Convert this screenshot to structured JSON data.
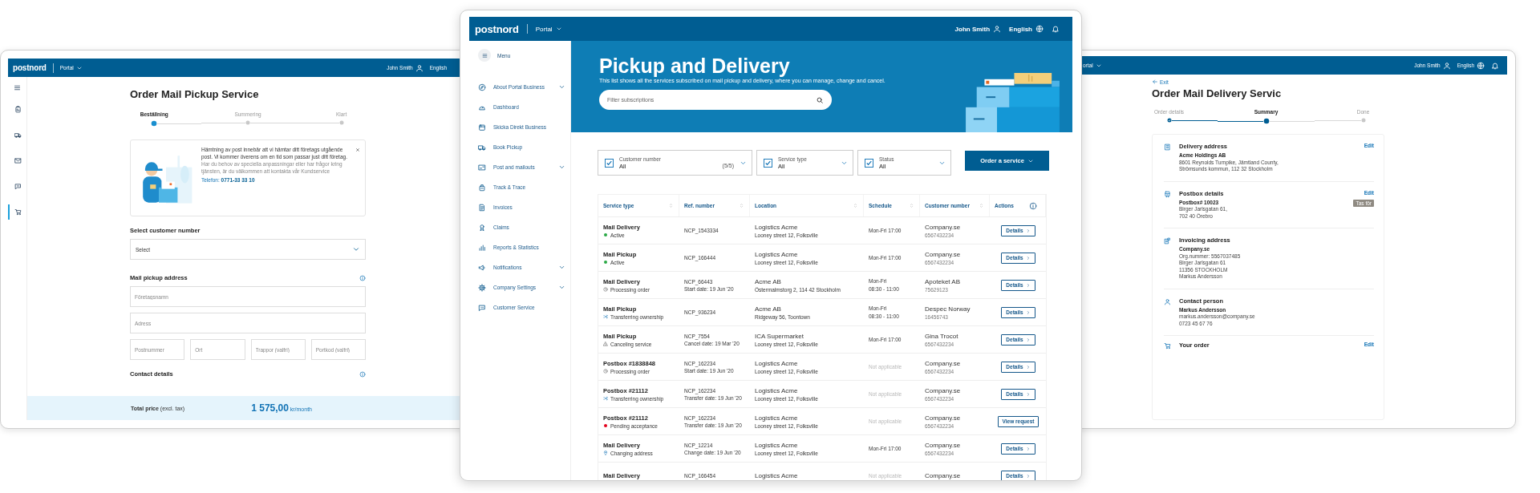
{
  "left_window": {
    "header": {
      "logo": "postnord",
      "portal": "Portal",
      "user": "John Smith",
      "language": "English"
    },
    "rail": [
      {
        "selected": false
      },
      {
        "selected": false
      },
      {
        "selected": false
      },
      {
        "selected": false
      },
      {
        "selected": true
      }
    ],
    "title": "Order Mail Pickup Service",
    "steps": [
      {
        "label": "Beställning",
        "selected": true,
        "done": false
      },
      {
        "label": "Summering",
        "selected": false,
        "done": false
      },
      {
        "label": "Klart",
        "selected": false,
        "done": false
      }
    ],
    "info": {
      "text": "Hämtning av post innebär att vi hämtar ditt företags utgående post. Vi kommer överens om en tid som passar just ditt företag.",
      "note": "Har du behov av speciella anpassningar eller har frågor kring tjänsten, är du välkommen att kontakta vår Kundservice",
      "phone_label": "Telefon:",
      "phone": "0771-33 33 10"
    },
    "customer_heading": "Select customer number",
    "customer_select": "Select",
    "address_heading": "Mail pickup address",
    "address_fields": [
      {
        "placeholder": "Företagsnamn"
      },
      {
        "placeholder": "Adress"
      }
    ],
    "address_small_fields": [
      {
        "placeholder": "Postnummer"
      },
      {
        "placeholder": "Ort"
      },
      {
        "placeholder": "Trappor (valfri)"
      },
      {
        "placeholder": "Portkod (valfri)"
      }
    ],
    "contact_heading": "Contact details",
    "total": {
      "label": "Total price",
      "note": "(excl. tax)",
      "amount": "1 575,00",
      "unit": "kr/month"
    }
  },
  "center_window": {
    "header": {
      "logo": "postnord",
      "portal": "Portal",
      "user": "John Smith",
      "language": "English"
    },
    "sidebar": {
      "menu": "Menu",
      "items": [
        {
          "label": "About Portal Business",
          "has_submenu": true
        },
        {
          "label": "Dashboard",
          "has_submenu": false
        },
        {
          "label": "Skicka Direkt Business",
          "has_submenu": false
        },
        {
          "label": "Book Pickup",
          "has_submenu": false
        },
        {
          "label": "Post and mailouts",
          "has_submenu": true
        },
        {
          "label": "Track & Trace",
          "has_submenu": false
        },
        {
          "label": "Invoices",
          "has_submenu": false
        },
        {
          "label": "Claims",
          "has_submenu": false
        },
        {
          "label": "Reports & Statistics",
          "has_submenu": false
        },
        {
          "label": "Notifications",
          "has_submenu": true
        },
        {
          "label": "Company Settings",
          "has_submenu": true
        },
        {
          "label": "Customer Service",
          "has_submenu": false
        }
      ]
    },
    "hero": {
      "title": "Pickup and Delivery",
      "subtitle": "This list shows all the services subscribed on mail pickup and delivery, where you can manage, change and cancel.",
      "search": {
        "placeholder": "Filter subscriptions"
      }
    },
    "filters": [
      {
        "label": "Customer number",
        "value": "All",
        "count": "(5/5)",
        "checked": true
      },
      {
        "label": "Service type",
        "value": "All",
        "checked": true
      },
      {
        "label": "Status",
        "value": "All",
        "checked": true
      }
    ],
    "order_button": "Order a service",
    "table": {
      "columns": [
        {
          "label": "Service type",
          "sortable": true,
          "info": false
        },
        {
          "label": "Ref. number",
          "sortable": true,
          "info": false
        },
        {
          "label": "Location",
          "sortable": true,
          "info": false
        },
        {
          "label": "Schedule",
          "sortable": true,
          "info": false
        },
        {
          "label": "Customer number",
          "sortable": true,
          "info": false
        },
        {
          "label": "Actions",
          "sortable": false,
          "info": true
        }
      ],
      "rows": [
        {
          "service": "Mail Delivery",
          "status": {
            "label": "Active",
            "kind": "active"
          },
          "ref": "NCP_1543334",
          "location": "Logistics Acme",
          "address": "Looney street 12, Folksville",
          "schedule": [
            "Mon-Fri 17:00"
          ],
          "schedule_applicable": true,
          "customer": "Company.se",
          "customer_number": "6567432234",
          "action": {
            "label": "Details",
            "kind": "details"
          }
        },
        {
          "service": "Mail Pickup",
          "status": {
            "label": "Active",
            "kind": "active"
          },
          "ref": "NCP_166444",
          "location": "Logistics Acme",
          "address": "Looney street 12, Folksville",
          "schedule": [
            "Mon-Fri 17:00"
          ],
          "schedule_applicable": true,
          "customer": "Company.se",
          "customer_number": "6567432234",
          "action": {
            "label": "Details",
            "kind": "details"
          }
        },
        {
          "service": "Mail Delivery",
          "status": {
            "label": "Processing order",
            "kind": "processing"
          },
          "ref": "NCP_66443",
          "ref_note": "Start date: 19 Jun '20",
          "location": "Acme AB",
          "address": "Östermalmstorg 2, 114 42 Stockholm",
          "schedule": [
            "Mon-Fri",
            "08:30 - 11:00"
          ],
          "schedule_applicable": true,
          "customer": "Apoteket AB",
          "customer_number": "75629123",
          "action": {
            "label": "Details",
            "kind": "details"
          }
        },
        {
          "service": "Mail Pickup",
          "status": {
            "label": "Transferring ownership",
            "kind": "transferring"
          },
          "ref": "NCP_936234",
          "location": "Acme AB",
          "address": "Ridgeway 56, Toontown",
          "schedule": [
            "Mon-Fri",
            "08:30 - 11:00"
          ],
          "schedule_applicable": true,
          "customer": "Despec Norway",
          "customer_number": "16456743",
          "action": {
            "label": "Details",
            "kind": "details"
          }
        },
        {
          "service": "Mail Pickup",
          "status": {
            "label": "Canceling service",
            "kind": "cancelling"
          },
          "ref": "NCP_7554",
          "ref_note": "Cancel date: 19 Mar '20",
          "location": "ICA Supermarket",
          "address": "Looney street 12, Folksville",
          "schedule": [
            "Mon-Fri 17:00"
          ],
          "schedule_applicable": true,
          "customer": "Gina Trocot",
          "customer_number": "6567432234",
          "action": {
            "label": "Details",
            "kind": "details"
          }
        },
        {
          "service": "Postbox #1838848",
          "status": {
            "label": "Processing order",
            "kind": "processing"
          },
          "ref": "NCP_162234",
          "ref_note": "Start date: 19 Jun '20",
          "location": "Logistics Acme",
          "address": "Looney street 12, Folksville",
          "schedule": [
            "Not applicable"
          ],
          "schedule_applicable": false,
          "customer": "Company.se",
          "customer_number": "6567432234",
          "action": {
            "label": "Details",
            "kind": "details"
          }
        },
        {
          "service": "Postbox #21112",
          "status": {
            "label": "Transferring ownership",
            "kind": "transferring"
          },
          "ref": "NCP_162234",
          "ref_note": "Transfer date: 19 Jun '20",
          "location": "Logistics Acme",
          "address": "Looney street 12, Folksville",
          "schedule": [
            "Not applicable"
          ],
          "schedule_applicable": false,
          "customer": "Company.se",
          "customer_number": "6567432234",
          "action": {
            "label": "Details",
            "kind": "details"
          }
        },
        {
          "service": "Postbox #21112",
          "status": {
            "label": "Pending acceptance",
            "kind": "pending"
          },
          "ref": "NCP_162234",
          "ref_note": "Transfer date: 19 Jun '20",
          "location": "Logistics Acme",
          "address": "Looney street 12, Folksville",
          "schedule": [
            "Not applicable"
          ],
          "schedule_applicable": false,
          "customer": "Company.se",
          "customer_number": "6567432234",
          "action": {
            "label": "View request",
            "kind": "request"
          }
        },
        {
          "service": "Mail Delivery",
          "status": {
            "label": "Changing address",
            "kind": "changing_address"
          },
          "ref": "NCP_12214",
          "ref_note": "Change date: 19 Jun '20",
          "location": "Logistics Acme",
          "address": "Looney street 12, Folksville",
          "schedule": [
            "Mon-Fri 17:00"
          ],
          "schedule_applicable": true,
          "customer": "Company.se",
          "customer_number": "6567432234",
          "action": {
            "label": "Details",
            "kind": "details"
          }
        },
        {
          "service": "Mail Delivery",
          "ref": "NCP_166454",
          "location": "Logistics Acme",
          "schedule": [
            "Not applicable"
          ],
          "schedule_applicable": false,
          "customer": "Company.se",
          "action": {
            "label": "Details",
            "kind": "details"
          }
        }
      ]
    }
  },
  "right_window": {
    "header": {
      "portal": "ortal",
      "user": "John Smith",
      "language": "English"
    },
    "back": "Exit",
    "title": "Order Mail Delivery Servic",
    "steps": [
      {
        "label": "Order details",
        "selected": false,
        "done": true
      },
      {
        "label": "Summary",
        "selected": true,
        "done": false
      },
      {
        "label": "Done",
        "selected": false,
        "done": false
      }
    ],
    "sections": [
      {
        "kind": "address",
        "heading": "Delivery address",
        "edit": "Edit",
        "lines": [
          {
            "text": "Acme Holdings AB",
            "strong": true
          },
          {
            "text": "8601 Reynolds Turnpike, Jämtland County,",
            "strong": false
          },
          {
            "text": "Strömsunds kommun, 112 32 Stockholm",
            "strong": false
          }
        ]
      },
      {
        "kind": "postbox",
        "heading": "Postbox details",
        "edit": "Edit",
        "badge": "Tas för",
        "lines": [
          {
            "text": "Postbox# 10023",
            "strong": true
          },
          {
            "text": "Birger Jarlsgatan 61,",
            "strong": false
          },
          {
            "text": "702 40 Örebro",
            "strong": false
          }
        ]
      },
      {
        "kind": "invoice",
        "heading": "Invoicing address",
        "lines": [
          {
            "text": "Company.se",
            "strong": true
          },
          {
            "text": "Org.nummer: 5567037485",
            "strong": false
          },
          {
            "text": "Birger Jarlsgatan 61",
            "strong": false
          },
          {
            "text": "11356 STOCKHOLM",
            "strong": false
          },
          {
            "text": "Markus Andersson",
            "strong": false
          }
        ]
      },
      {
        "kind": "contact",
        "heading": "Contact person",
        "lines": [
          {
            "text": "Markus Andersson",
            "strong": true
          },
          {
            "text": "markus.andersson@company.se",
            "strong": false
          },
          {
            "text": "0723 45 67 76",
            "strong": false
          }
        ]
      },
      {
        "kind": "order",
        "heading": "Your order",
        "edit": "Edit"
      }
    ]
  }
}
